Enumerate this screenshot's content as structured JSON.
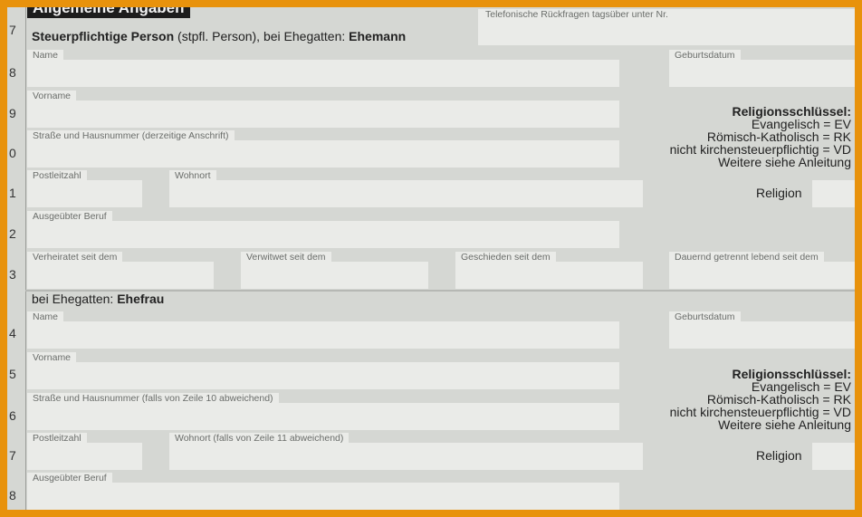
{
  "section": {
    "title": "Allgemeine Angaben"
  },
  "phone": {
    "label": "Telefonische Rückfragen tagsüber unter Nr."
  },
  "person1": {
    "heading_bold": "Steuerpflichtige Person",
    "heading_mid": " (stpfl. Person), bei Ehegatten: ",
    "heading_role": "Ehemann",
    "name_label": "Name",
    "geburtsdatum_label": "Geburtsdatum",
    "vorname_label": "Vorname",
    "strasse_label": "Straße und Hausnummer (derzeitige Anschrift)",
    "plz_label": "Postleitzahl",
    "wohnort_label": "Wohnort",
    "beruf_label": "Ausgeübter Beruf",
    "verheiratet_label": "Verheiratet seit dem",
    "verwitwet_label": "Verwitwet seit dem",
    "geschieden_label": "Geschieden seit dem",
    "getrennt_label": "Dauernd getrennt lebend seit dem"
  },
  "person2": {
    "heading_mid": "bei Ehegatten: ",
    "heading_role": "Ehefrau",
    "name_label": "Name",
    "geburtsdatum_label": "Geburtsdatum",
    "vorname_label": "Vorname",
    "strasse_label": "Straße und Hausnummer (falls von Zeile 10 abweichend)",
    "plz_label": "Postleitzahl",
    "wohnort_label": "Wohnort (falls von Zeile 11 abweichend)",
    "beruf_label": "Ausgeübter Beruf"
  },
  "religion": {
    "title": "Religionsschlüssel:",
    "line1": "Evangelisch = EV",
    "line2": "Römisch-Katholisch = RK",
    "line3": "nicht kirchensteuerpflichtig = VD",
    "line4": "Weitere siehe Anleitung",
    "field_label": "Religion"
  },
  "rows": [
    "7",
    "8",
    "9",
    "0",
    "1",
    "2",
    "3",
    "4",
    "5",
    "6",
    "7",
    "8"
  ]
}
